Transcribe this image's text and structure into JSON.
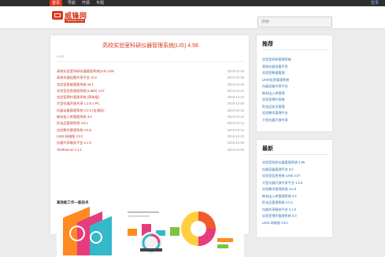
{
  "topnav": {
    "items": [
      "首页",
      "导航",
      "开源",
      "专题"
    ],
    "login": "登录"
  },
  "logo": {
    "name": "威锋网",
    "tagline": "VEEFENG.COM"
  },
  "search": {
    "placeholder": "搜索"
  },
  "article": {
    "title": "高校实验室科研仪器管理系统(LIS) 4.56",
    "meta": "LIMS",
    "links": [
      {
        "title": "高校实验室科研仪器管理系统(LIS) 4.56",
        "date": "2019-12-30"
      },
      {
        "title": "高校仪器设备共享平台 v3.2",
        "date": "2019-12-28"
      },
      {
        "title": "实验室智能管理系统 v6.1",
        "date": "2019-12-26"
      },
      {
        "title": "实验室信息管理系统 (LIMS) 4.07",
        "date": "2019-12-24"
      },
      {
        "title": "实验室预约管理系统 (简体版)",
        "date": "2019-12-22"
      },
      {
        "title": "大型仪器开放共享 1.2.5.1 PC",
        "date": "2019-12-20"
      },
      {
        "title": "仪器设备管理系统 2.0.0 (含源码)",
        "date": "2019-12-18"
      },
      {
        "title": "耗材出入库管理系统 3.5",
        "date": "2019-12-16"
      },
      {
        "title": "危化品管理系统 4.0.1",
        "date": "2019-12-14"
      },
      {
        "title": "实验教学管理系统 4.5.8",
        "date": "2019-12-12"
      },
      {
        "title": "LIMS 网络版 V3.0",
        "date": "2019-12-10"
      },
      {
        "title": "仪器共享服务平台 2.1.0",
        "date": "2019-12-08"
      },
      {
        "title": "TestRunner 2.1.1",
        "date": "2019-12-06"
      }
    ],
    "banner_title": "高效能工作一般技术"
  },
  "colors": {
    "accent": "#d9381e",
    "link": "#2a6fb7",
    "topbar": "#2e2e2e"
  },
  "sidebar": {
    "box1_title": "推荐",
    "box1_items": [
      "实验室科研管理系统",
      "高校仪器设备平台",
      "实验室数据管理",
      "LIMS信息管理系统",
      "仪器设备共享平台",
      "耗材出入库管理",
      "实验室预约系统",
      "危化品安全管理",
      "实验教学管理平台",
      "大型仪器开放共享"
    ],
    "box2_title": "最新",
    "box2_items": [
      "实验室科研仪器管理系统 4.56",
      "仪器设备管理平台 3.2",
      "实验室信息系统 LIMS 4.07",
      "大型仪器开放共享平台 1.2.5",
      "实验教学管理系统 4.5.8",
      "耗材出入库管理系统 3.5",
      "危化品管理系统 4.0.1",
      "仪器共享服务平台 2.1.0",
      "实验室预约管理系统 3.0",
      "LIMS 网络版 V3.0"
    ]
  }
}
